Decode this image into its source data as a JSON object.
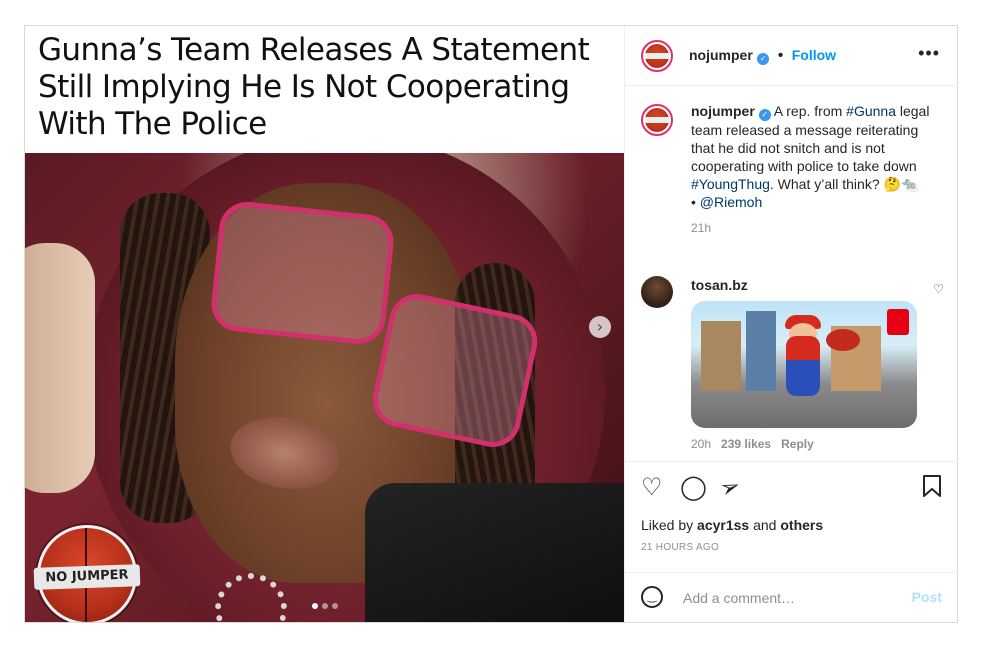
{
  "post": {
    "headline": "Gunna’s Team Releases A Statement Still Implying He Is Not Cooperating With The Police",
    "logo_text": "NO JUMPER"
  },
  "header": {
    "username": "nojumper",
    "separator": "•",
    "follow": "Follow",
    "more": "•••"
  },
  "caption": {
    "username": "nojumper",
    "text_1": "A rep. from ",
    "hashtag_1": "#Gunna",
    "text_2": " legal team released a message reiterating that he did not snitch and is not cooperating with police to take down ",
    "hashtag_2": "#YoungThug",
    "text_3": ". What y’all think? 🤔🐀",
    "credit_prefix": "• ",
    "mention": "@Riemoh",
    "time": "21h"
  },
  "comment": {
    "username": "tosan.bz",
    "time": "20h",
    "likes": "239 likes",
    "reply": "Reply"
  },
  "actions": {
    "liked_prefix": "Liked by ",
    "liked_user": "acyr1ss",
    "liked_and": " and ",
    "liked_others": "others",
    "timestamp": "21 HOURS AGO"
  },
  "composer": {
    "placeholder": "Add a comment…",
    "post": "Post"
  },
  "icons": {
    "verified": "verified-badge",
    "like": "heart-icon",
    "comment": "comment-icon",
    "share": "send-icon",
    "save": "bookmark-icon",
    "emoji": "emoji-icon",
    "next": "chevron-right-icon"
  },
  "colors": {
    "accent": "#0095f6",
    "hashtag": "#00376b",
    "muted": "#8e8e8e",
    "post_disabled": "#b2dffc"
  }
}
